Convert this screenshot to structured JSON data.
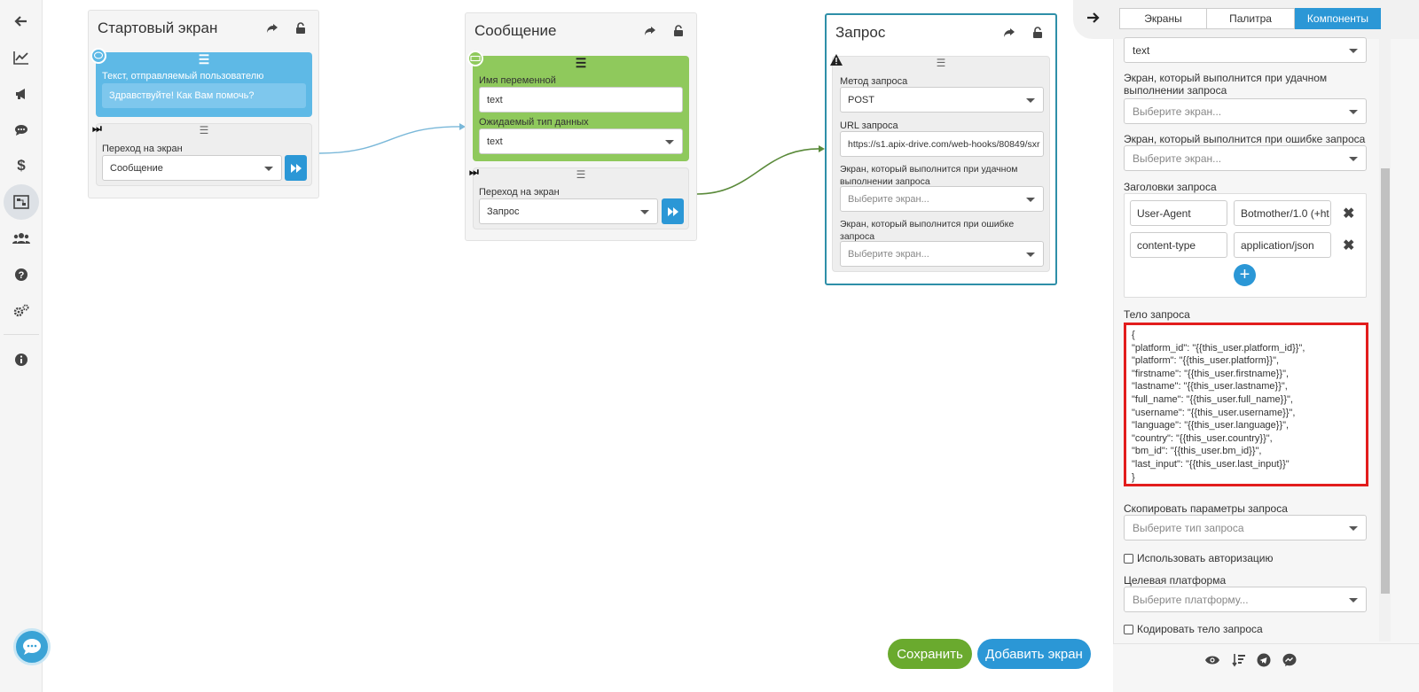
{
  "sidebar": {
    "items": [
      {
        "icon": "arrow-left-icon"
      },
      {
        "icon": "chart-line-icon"
      },
      {
        "icon": "megaphone-icon"
      },
      {
        "icon": "comments-icon"
      },
      {
        "icon": "dollar-icon"
      },
      {
        "icon": "screens-icon"
      },
      {
        "icon": "users-icon"
      },
      {
        "icon": "question-icon"
      },
      {
        "icon": "settings-icon"
      },
      {
        "icon": "info-icon"
      }
    ]
  },
  "screens": {
    "start": {
      "title": "Стартовый экран",
      "message_label": "Текст, отправляемый пользователю",
      "message_text": "Здравствуйте! Как Вам помочь?",
      "transition_label": "Переход на экран",
      "transition_value": "Сообщение"
    },
    "message": {
      "title": "Сообщение",
      "var_label": "Имя переменной",
      "var_value": "text",
      "type_label": "Ожидаемый тип данных",
      "type_value": "text",
      "transition_label": "Переход на экран",
      "transition_value": "Запрос"
    },
    "request": {
      "title": "Запрос",
      "method_label": "Метод запроса",
      "method_value": "POST",
      "url_label": "URL запроса",
      "url_value": "https://s1.apix-drive.com/web-hooks/80849/sxr",
      "success_label": "Экран, который выполнится при удачном выполнении запроса",
      "success_placeholder": "Выберите экран...",
      "error_label": "Экран, который выполнится при ошибке запроса",
      "error_placeholder": "Выберите экран..."
    }
  },
  "actions": {
    "save": "Сохранить",
    "add_screen": "Добавить экран"
  },
  "panel": {
    "tabs": [
      "Экраны",
      "Палитра",
      "Компоненты"
    ],
    "active_tab": "Компоненты",
    "top_select_value": "text",
    "success_label": "Экран, который выполнится при удачном выполнении запроса",
    "success_placeholder": "Выберите экран...",
    "error_label": "Экран, который выполнится при ошибке запроса",
    "error_placeholder": "Выберите экран...",
    "headers_label": "Заголовки запроса",
    "headers": [
      {
        "key": "User-Agent",
        "value": "Botmother/1.0 (+ht"
      },
      {
        "key": "content-type",
        "value": "application/json"
      }
    ],
    "body_label": "Тело запроса",
    "body_text": "{\n\"platform_id\": \"{{this_user.platform_id}}\",\n\"platform\": \"{{this_user.platform}}\",\n\"firstname\": \"{{this_user.firstname}}\",\n\"lastname\": \"{{this_user.lastname}}\",\n\"full_name\": \"{{this_user.full_name}}\",\n\"username\": \"{{this_user.username}}\",\n\"language\": \"{{this_user.language}}\",\n\"country\": \"{{this_user.country}}\",\n\"bm_id\": \"{{this_user.bm_id}}\",\n\"last_input\": \"{{this_user.last_input}}\"\n}",
    "copy_label": "Скопировать параметры запроса",
    "copy_placeholder": "Выберите тип запроса",
    "auth_label": "Использовать авторизацию",
    "platform_label": "Целевая платформа",
    "platform_placeholder": "Выберите платформу...",
    "encode_label": "Кодировать тело запроса"
  },
  "colors": {
    "accent": "#2b97d6",
    "start_block": "#5eb9e6",
    "message_block": "#8fc95c",
    "save_button": "#6aaa2e",
    "highlight": "#e21d1d"
  }
}
